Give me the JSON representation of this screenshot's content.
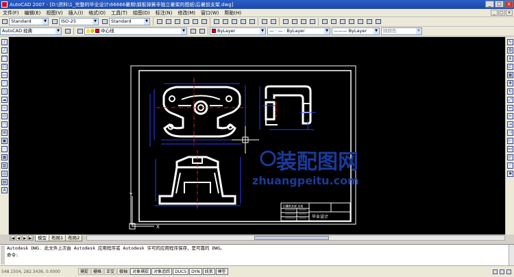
{
  "titlebar": {
    "title": "AutoCAD 2007 - [D:\\资料\\1_完整的毕业设计\\66666暑期\\钢板弹簧非独立暑架的图纸\\后暑前支架.dwg]",
    "minimize": "_",
    "maximize": "□",
    "close": "×"
  },
  "menu": {
    "items": [
      "文件(F)",
      "编辑(E)",
      "视图(V)",
      "插入(I)",
      "格式(O)",
      "工具(T)",
      "绘图(D)",
      "标注(N)",
      "修改(M)",
      "窗口(W)",
      "帮助(H)"
    ],
    "mdi_buttons": [
      "_",
      "□",
      "×"
    ]
  },
  "toolbar1": {
    "text_style": "Standard",
    "dim_style": "ISO-25",
    "table_style": "Standard"
  },
  "toolbar2": {
    "workspace": "AutoCAD 经典",
    "layer": "中心线",
    "color": "ByLayer",
    "linetype": "ByLayer",
    "lineweight": "ByLayer",
    "plotstyle": "随颜色",
    "linetype_preview": "— · — ·",
    "lineweight_preview": "———"
  },
  "drawing": {
    "watermark_cn": "装配图网",
    "watermark_url": "zhuangpeitu.com",
    "title_block_label": "毕业设计",
    "title_block_small": "后暑前支架 支架",
    "ucs_y": "Y",
    "ucs_x": "X"
  },
  "layout_tabs": {
    "tabs": [
      "模型",
      "布局1",
      "布局2"
    ],
    "active": "模型",
    "nav": [
      "|◀",
      "◀",
      "▶",
      "▶|"
    ]
  },
  "command": {
    "line1": "Autodesk DWG.    此文件上次由 Autodesk 应用程序或 Autodesk 许可的应用程序保存，是可靠的 DWG。",
    "line2": "命令:",
    "line3": ""
  },
  "status": {
    "coords": "548.1504, 282.3436, 0.0000",
    "buttons": [
      "捕捉",
      "栅格",
      "正交",
      "极轴",
      "对象捕捉",
      "对象追踪",
      "DUCS",
      "DYN",
      "线宽",
      "模型"
    ],
    "on_buttons": [
      "对象捕捉",
      "对象追踪",
      "DUCS",
      "DYN",
      "线宽",
      "模型"
    ]
  },
  "colors": {
    "titlebar": "#1b46a8",
    "canvas": "#000000",
    "geometry": "#ffffff",
    "dimension": "#0000ff",
    "centerline": "#ff0000",
    "watermark": "#1a3a9a"
  },
  "icons": {
    "left_toolbar": [
      "line-icon",
      "construction-line-icon",
      "polyline-icon",
      "polygon-icon",
      "rectangle-icon",
      "arc-icon",
      "circle-icon",
      "revision-cloud-icon",
      "spline-icon",
      "ellipse-icon",
      "ellipse-arc-icon",
      "insert-block-icon",
      "make-block-icon",
      "point-icon",
      "hatch-icon",
      "gradient-icon",
      "region-icon",
      "table-icon",
      "mtext-icon"
    ],
    "right_toolbar": [
      "erase-icon",
      "copy-icon",
      "mirror-icon",
      "offset-icon",
      "array-icon",
      "move-icon",
      "rotate-icon",
      "scale-icon",
      "stretch-icon",
      "trim-icon",
      "extend-icon",
      "break-at-point-icon",
      "break-icon",
      "join-icon",
      "chamfer-icon",
      "fillet-icon",
      "explode-icon"
    ]
  }
}
